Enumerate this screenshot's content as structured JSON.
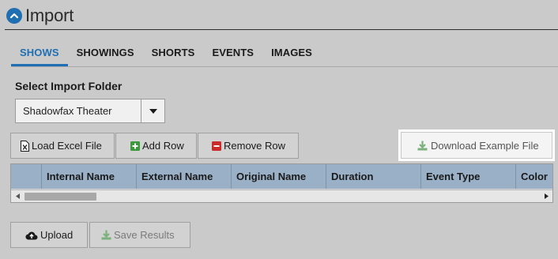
{
  "header": {
    "title": "Import",
    "icon": "chevron-up-circle-icon",
    "accent_color": "#1f6fb2"
  },
  "tabs": [
    {
      "label": "SHOWS",
      "active": true
    },
    {
      "label": "SHOWINGS",
      "active": false
    },
    {
      "label": "SHORTS",
      "active": false
    },
    {
      "label": "EVENTS",
      "active": false
    },
    {
      "label": "IMAGES",
      "active": false
    }
  ],
  "folder": {
    "label": "Select Import Folder",
    "selected": "Shadowfax Theater"
  },
  "toolbar": {
    "load_excel_label": "Load Excel File",
    "add_row_label": "Add Row",
    "remove_row_label": "Remove Row",
    "download_example_label": "Download Example File"
  },
  "grid": {
    "columns": [
      "",
      "Internal Name",
      "External Name",
      "Original Name",
      "Duration",
      "Event Type",
      "Color"
    ],
    "header_color": "#9ab0c7"
  },
  "actions": {
    "upload_label": "Upload",
    "save_results_label": "Save Results"
  },
  "colors": {
    "add_green": "#3c9a3c",
    "remove_red": "#cc2b2b",
    "download_green": "#7cb07c"
  }
}
